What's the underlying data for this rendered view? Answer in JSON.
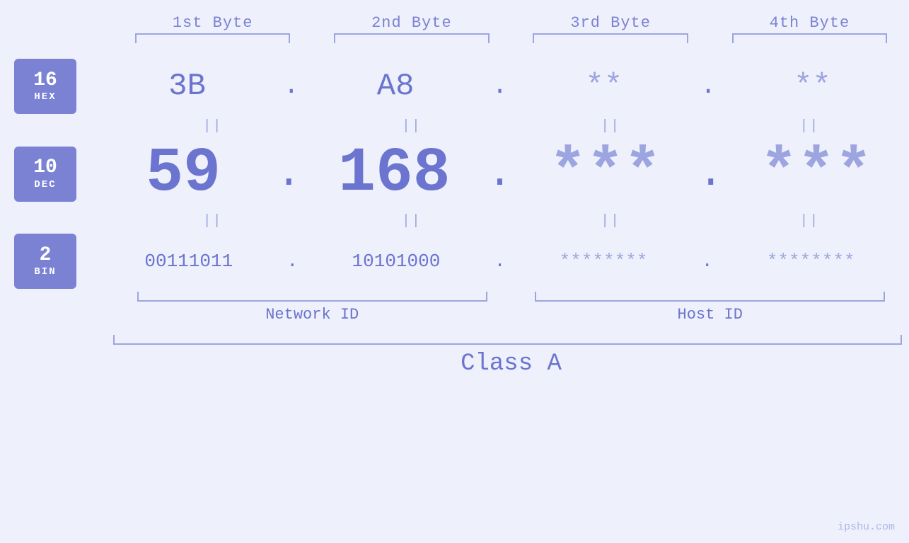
{
  "headers": {
    "byte1": "1st Byte",
    "byte2": "2nd Byte",
    "byte3": "3rd Byte",
    "byte4": "4th Byte"
  },
  "bases": {
    "hex": {
      "number": "16",
      "label": "HEX"
    },
    "dec": {
      "number": "10",
      "label": "DEC"
    },
    "bin": {
      "number": "2",
      "label": "BIN"
    }
  },
  "values": {
    "hex": {
      "b1": "3B",
      "b2": "A8",
      "b3": "**",
      "b4": "**"
    },
    "dec": {
      "b1": "59",
      "b2": "168",
      "b3": "***",
      "b4": "***"
    },
    "bin": {
      "b1": "00111011",
      "b2": "10101000",
      "b3": "********",
      "b4": "********"
    }
  },
  "labels": {
    "network_id": "Network ID",
    "host_id": "Host ID",
    "class": "Class A"
  },
  "watermark": "ipshu.com",
  "separator": "||"
}
